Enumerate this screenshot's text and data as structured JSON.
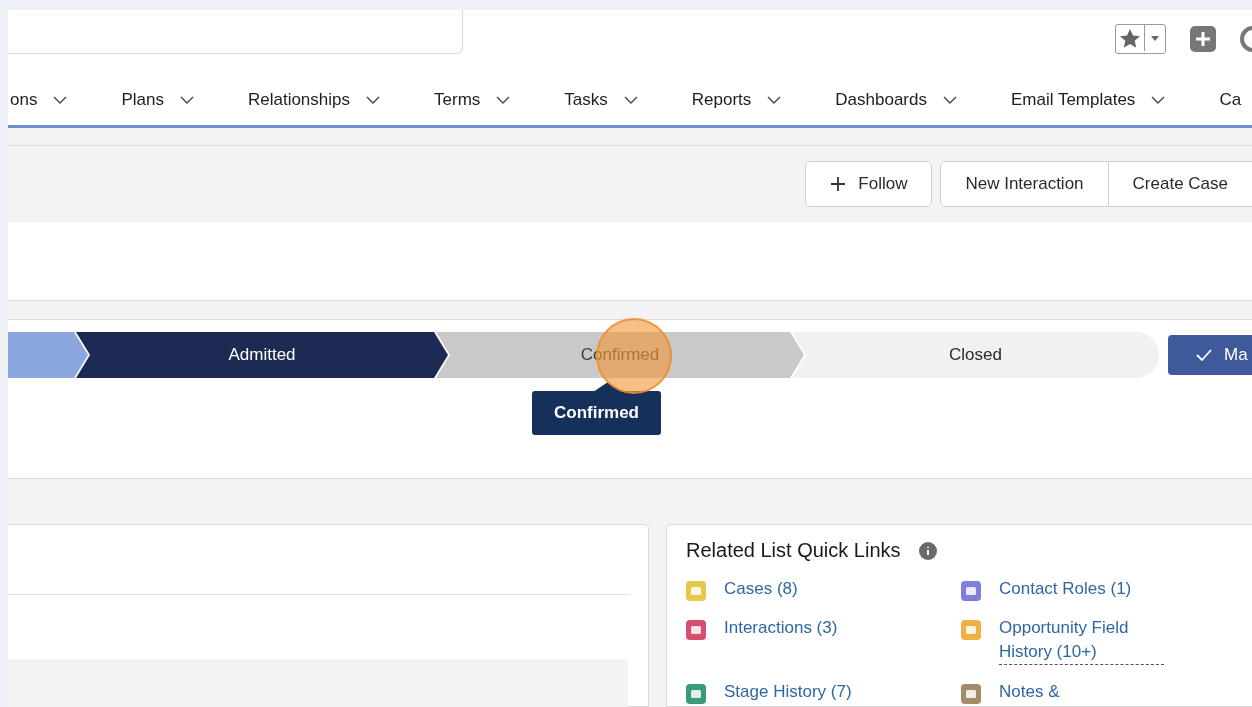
{
  "nav": {
    "items": [
      {
        "label": "ons",
        "chevron": true
      },
      {
        "label": "Plans",
        "chevron": true
      },
      {
        "label": "Relationships",
        "chevron": true
      },
      {
        "label": "Terms",
        "chevron": true
      },
      {
        "label": "Tasks",
        "chevron": true
      },
      {
        "label": "Reports",
        "chevron": true
      },
      {
        "label": "Dashboards",
        "chevron": true
      },
      {
        "label": "Email Templates",
        "chevron": true
      },
      {
        "label": "Ca"
      }
    ]
  },
  "actions": [
    {
      "label": "Follow",
      "kind": "follow"
    },
    {
      "label": "New Interaction",
      "kind": "group"
    },
    {
      "label": "Create Case",
      "kind": "group"
    }
  ],
  "path": {
    "stages": [
      {
        "completed": true,
        "selected": false,
        "hovered": false
      },
      {
        "label": "Admitted",
        "completed": false,
        "selected": true,
        "hovered": false
      },
      {
        "label": "Confirmed",
        "completed": false,
        "selected": false,
        "hovered": true
      },
      {
        "label": "Closed",
        "completed": false,
        "selected": false,
        "hovered": false
      }
    ],
    "tooltip": "Confirmed",
    "mark_button": "Ma"
  },
  "click_highlight": true,
  "quick_links": {
    "title": "Related List Quick Links",
    "links": [
      {
        "label": "Cases (8)",
        "color": "#e6c84c"
      },
      {
        "label": "Contact Roles (1)",
        "color": "#7e7fdc"
      },
      {
        "label": "Interactions (3)",
        "color": "#d6506e"
      },
      {
        "label": "Opportunity Field History (10+)",
        "color": "#f0b143",
        "dotted": true
      },
      {
        "label": "Stage History (7)",
        "color": "#3c9a78"
      },
      {
        "label": "Notes &",
        "color": "#a38c6c"
      }
    ]
  }
}
